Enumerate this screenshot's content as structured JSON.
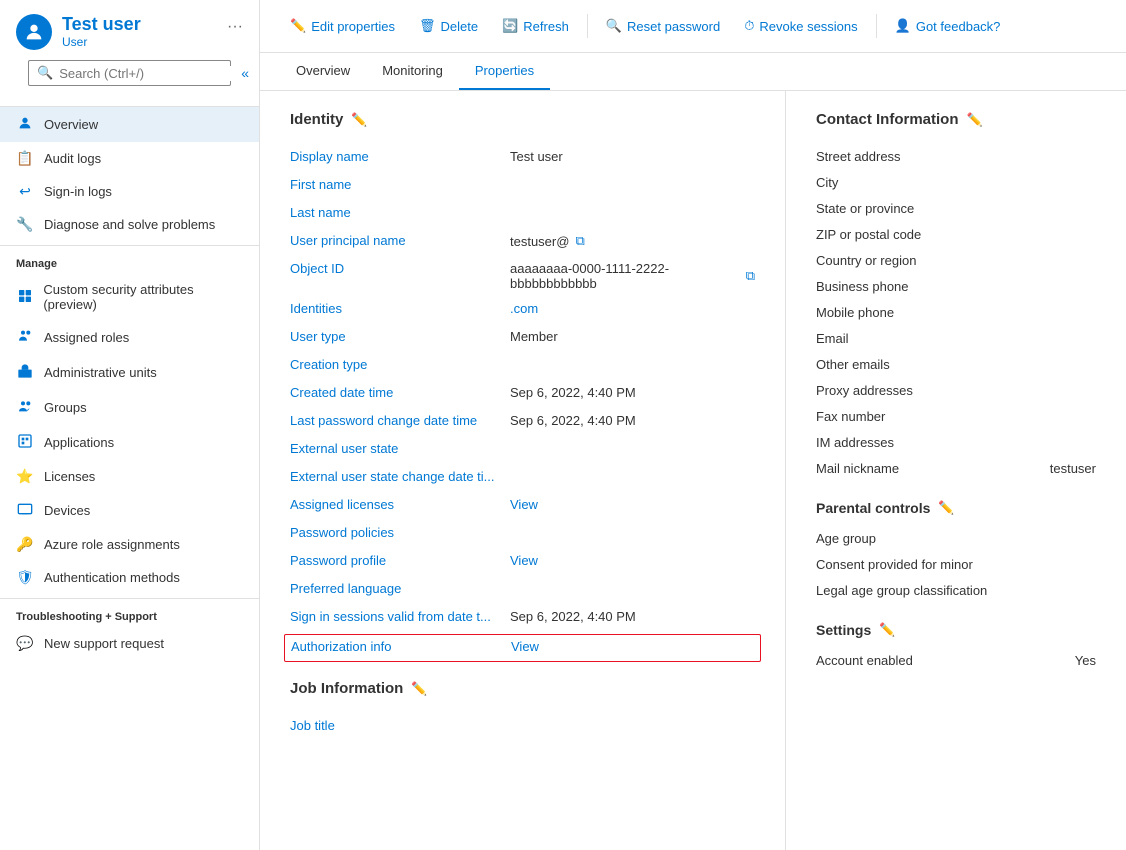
{
  "user": {
    "name": "Test user",
    "role": "User"
  },
  "search": {
    "placeholder": "Search (Ctrl+/)"
  },
  "sidebar": {
    "nav_items": [
      {
        "id": "overview",
        "label": "Overview",
        "icon": "👤",
        "active": true
      },
      {
        "id": "audit-logs",
        "label": "Audit logs",
        "icon": "📋"
      },
      {
        "id": "sign-in-logs",
        "label": "Sign-in logs",
        "icon": "↩"
      },
      {
        "id": "diagnose",
        "label": "Diagnose and solve problems",
        "icon": "🔧"
      }
    ],
    "manage_section": "Manage",
    "manage_items": [
      {
        "id": "custom-security",
        "label": "Custom security attributes (preview)",
        "icon": "🏷"
      },
      {
        "id": "assigned-roles",
        "label": "Assigned roles",
        "icon": "👥"
      },
      {
        "id": "admin-units",
        "label": "Administrative units",
        "icon": "🏢"
      },
      {
        "id": "groups",
        "label": "Groups",
        "icon": "👥"
      },
      {
        "id": "applications",
        "label": "Applications",
        "icon": "⬜"
      },
      {
        "id": "licenses",
        "label": "Licenses",
        "icon": "⭐"
      },
      {
        "id": "devices",
        "label": "Devices",
        "icon": "💻"
      },
      {
        "id": "azure-role",
        "label": "Azure role assignments",
        "icon": "🔑"
      },
      {
        "id": "auth-methods",
        "label": "Authentication methods",
        "icon": "🛡"
      }
    ],
    "support_section": "Troubleshooting + Support",
    "support_items": [
      {
        "id": "new-support",
        "label": "New support request",
        "icon": "💬"
      }
    ]
  },
  "toolbar": {
    "edit_label": "Edit properties",
    "delete_label": "Delete",
    "refresh_label": "Refresh",
    "reset_password_label": "Reset password",
    "revoke_sessions_label": "Revoke sessions",
    "feedback_label": "Got feedback?"
  },
  "tabs": [
    {
      "id": "overview",
      "label": "Overview"
    },
    {
      "id": "monitoring",
      "label": "Monitoring"
    },
    {
      "id": "properties",
      "label": "Properties",
      "active": true
    }
  ],
  "identity": {
    "section_title": "Identity",
    "fields": [
      {
        "label": "Display name",
        "value": "Test user",
        "type": "text"
      },
      {
        "label": "First name",
        "value": "",
        "type": "text"
      },
      {
        "label": "Last name",
        "value": "",
        "type": "text"
      },
      {
        "label": "User principal name",
        "value": "testuser@",
        "type": "copy"
      },
      {
        "label": "Object ID",
        "value": "aaaaaaaa-0000-1111-2222-bbbbbbbbbbbb",
        "type": "copy"
      },
      {
        "label": "Identities",
        "value": ".com",
        "type": "link-value"
      },
      {
        "label": "User type",
        "value": "Member",
        "type": "text"
      },
      {
        "label": "Creation type",
        "value": "",
        "type": "text"
      },
      {
        "label": "Created date time",
        "value": "Sep 6, 2022, 4:40 PM",
        "type": "text"
      },
      {
        "label": "Last password change date time",
        "value": "Sep 6, 2022, 4:40 PM",
        "type": "text"
      },
      {
        "label": "External user state",
        "value": "",
        "type": "text"
      },
      {
        "label": "External user state change date ti...",
        "value": "",
        "type": "text"
      },
      {
        "label": "Assigned licenses",
        "value": "View",
        "type": "link"
      },
      {
        "label": "Password policies",
        "value": "",
        "type": "text"
      },
      {
        "label": "Password profile",
        "value": "View",
        "type": "link"
      },
      {
        "label": "Preferred language",
        "value": "",
        "type": "text"
      },
      {
        "label": "Sign in sessions valid from date t...",
        "value": "Sep 6, 2022, 4:40 PM",
        "type": "text"
      },
      {
        "label": "Authorization info",
        "value": "View",
        "type": "link",
        "highlighted": true
      }
    ]
  },
  "job_info": {
    "section_title": "Job Information",
    "fields": [
      {
        "label": "Job title",
        "value": "",
        "type": "text"
      }
    ]
  },
  "contact_info": {
    "section_title": "Contact Information",
    "fields": [
      {
        "label": "Street address",
        "value": ""
      },
      {
        "label": "City",
        "value": ""
      },
      {
        "label": "State or province",
        "value": ""
      },
      {
        "label": "ZIP or postal code",
        "value": ""
      },
      {
        "label": "Country or region",
        "value": ""
      },
      {
        "label": "Business phone",
        "value": ""
      },
      {
        "label": "Mobile phone",
        "value": ""
      },
      {
        "label": "Email",
        "value": ""
      },
      {
        "label": "Other emails",
        "value": ""
      },
      {
        "label": "Proxy addresses",
        "value": ""
      },
      {
        "label": "Fax number",
        "value": ""
      },
      {
        "label": "IM addresses",
        "value": ""
      },
      {
        "label": "Mail nickname",
        "value": "testuser"
      }
    ]
  },
  "parental_controls": {
    "section_title": "Parental controls",
    "fields": [
      {
        "label": "Age group",
        "value": ""
      },
      {
        "label": "Consent provided for minor",
        "value": ""
      },
      {
        "label": "Legal age group classification",
        "value": ""
      }
    ]
  },
  "settings": {
    "section_title": "Settings",
    "fields": [
      {
        "label": "Account enabled",
        "value": "Yes"
      }
    ]
  }
}
